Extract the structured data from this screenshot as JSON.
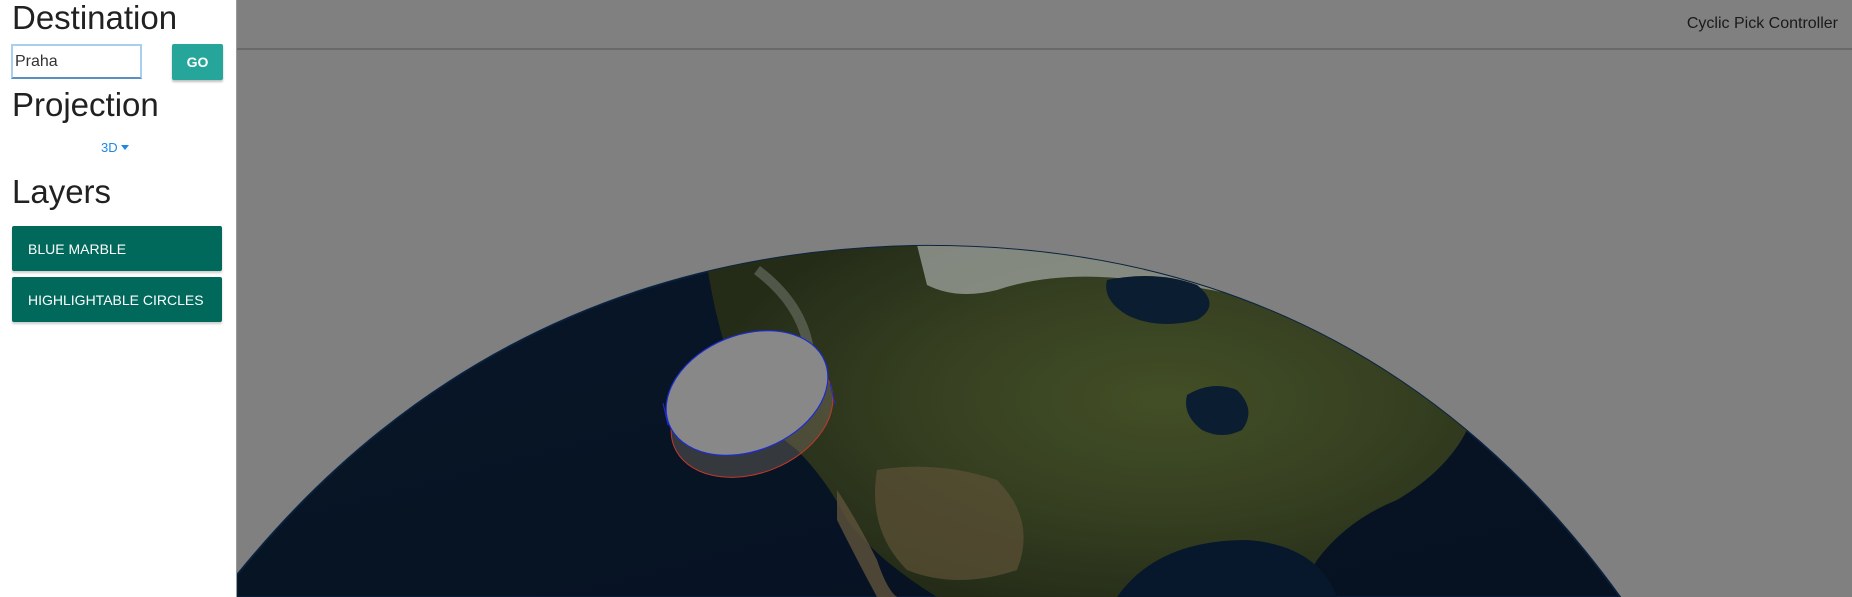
{
  "sidebar": {
    "destination_heading": "Destination",
    "destination_value": "Praha",
    "go_label": "GO",
    "projection_heading": "Projection",
    "projection_selected": "3D",
    "layers_heading": "Layers",
    "layers": [
      {
        "label": "BLUE MARBLE"
      },
      {
        "label": "HIGHLIGHTABLE CIRCLES"
      }
    ]
  },
  "header": {
    "title": "Cyclic Pick Controller"
  },
  "colors": {
    "go_button": "#26a69a",
    "layer_button": "#00695c",
    "link_blue": "#1e88e5",
    "viewport_bg": "#808080"
  }
}
